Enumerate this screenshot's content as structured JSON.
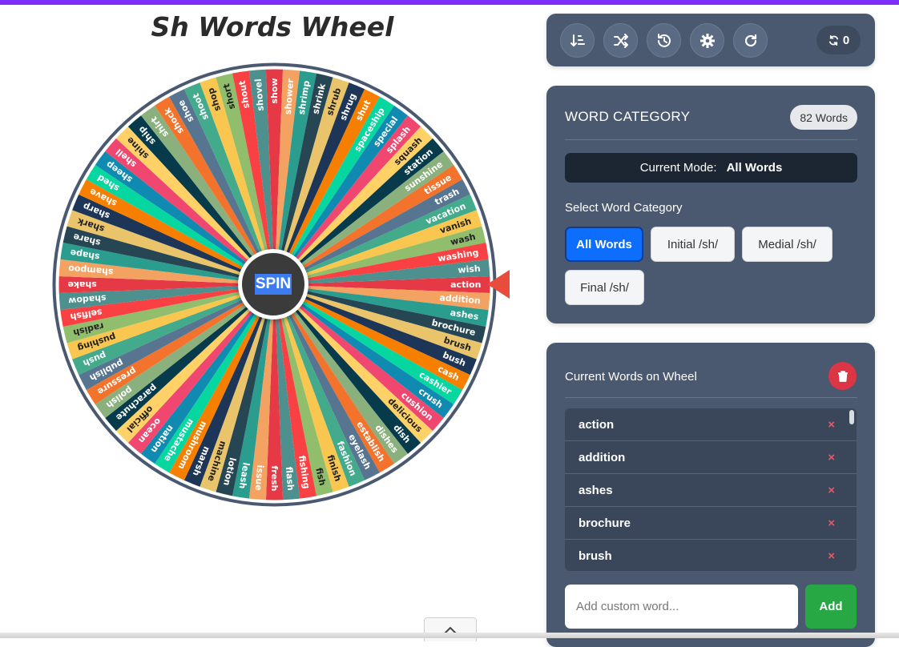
{
  "title": "Sh Words Wheel",
  "spin_label": "SPIN",
  "toolbar": {
    "icons": [
      "sort-icon",
      "shuffle-icon",
      "history-icon",
      "gear-icon",
      "reset-icon"
    ],
    "spin_count": "0"
  },
  "category": {
    "title": "WORD CATEGORY",
    "badge": "82 Words",
    "mode_label": "Current Mode:",
    "mode_value": "All Words",
    "select_label": "Select Word Category",
    "buttons": [
      "All Words",
      "Initial /sh/",
      "Medial /sh/",
      "Final /sh/"
    ]
  },
  "words_panel": {
    "title": "Current Words on Wheel",
    "items": [
      "action",
      "addition",
      "ashes",
      "brochure",
      "brush"
    ],
    "remove_symbol": "×",
    "input_placeholder": "Add custom word...",
    "add_label": "Add"
  },
  "wheel": {
    "words": [
      "action",
      "addition",
      "ashes",
      "brochure",
      "brush",
      "bush",
      "cash",
      "cashier",
      "crush",
      "cushion",
      "delicious",
      "dish",
      "dishes",
      "establish",
      "eyelash",
      "fashion",
      "finish",
      "fish",
      "fishing",
      "flash",
      "fresh",
      "issue",
      "leash",
      "lotion",
      "machine",
      "marsh",
      "mushroom",
      "mustache",
      "nation",
      "ocean",
      "official",
      "parachute",
      "polish",
      "pressure",
      "publish",
      "push",
      "pushing",
      "radish",
      "selfish",
      "shadow",
      "shake",
      "shampoo",
      "shape",
      "share",
      "shark",
      "sharp",
      "shave",
      "shed",
      "sheep",
      "shell",
      "shine",
      "ship",
      "shirt",
      "shock",
      "shoe",
      "shoot",
      "shop",
      "short",
      "shout",
      "shovel",
      "show",
      "shower",
      "shrimp",
      "shrink",
      "shrub",
      "shrug",
      "shut",
      "spaceship",
      "special",
      "splash",
      "squash",
      "station",
      "sunshine",
      "tissue",
      "trash",
      "vacation",
      "vanish",
      "wash",
      "washing",
      "wish"
    ],
    "colors": [
      "#e63946",
      "#f4a261",
      "#2a9d8f",
      "#264653",
      "#e9c46a",
      "#1d3557",
      "#f77f00",
      "#06d6a0",
      "#118ab2",
      "#ef476f",
      "#ffd166",
      "#073b4c",
      "#8ab17d",
      "#f3722c",
      "#577590",
      "#43aa8b",
      "#f9c74f",
      "#90be6d",
      "#f94144",
      "#4d908e"
    ],
    "text_dark_indices": [
      4,
      10,
      16,
      17
    ],
    "pointer_color": "#e74c3c",
    "rim_color": "#4a5970"
  }
}
